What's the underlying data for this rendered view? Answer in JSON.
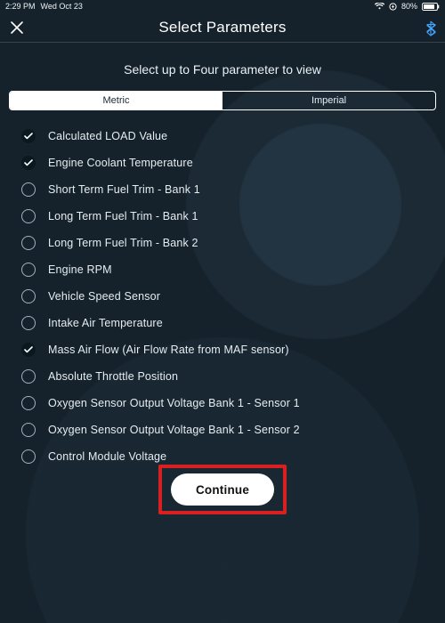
{
  "status": {
    "time": "2:29 PM",
    "date": "Wed Oct 23",
    "battery_pct": "80%"
  },
  "header": {
    "title": "Select Parameters"
  },
  "subtitle": "Select up to Four parameter to view",
  "units": {
    "metric_label": "Metric",
    "imperial_label": "Imperial",
    "active": "metric"
  },
  "parameters": [
    {
      "label": "Calculated LOAD Value",
      "checked": true
    },
    {
      "label": "Engine Coolant Temperature",
      "checked": true
    },
    {
      "label": "Short Term Fuel Trim - Bank 1",
      "checked": false
    },
    {
      "label": "Long Term Fuel Trim - Bank 1",
      "checked": false
    },
    {
      "label": "Long Term Fuel Trim - Bank 2",
      "checked": false
    },
    {
      "label": "Engine RPM",
      "checked": false
    },
    {
      "label": "Vehicle Speed Sensor",
      "checked": false
    },
    {
      "label": "Intake Air Temperature",
      "checked": false
    },
    {
      "label": "Mass Air Flow (Air Flow Rate from MAF sensor)",
      "checked": true
    },
    {
      "label": "Absolute Throttle Position",
      "checked": false
    },
    {
      "label": "Oxygen Sensor Output Voltage Bank 1 - Sensor 1",
      "checked": false
    },
    {
      "label": "Oxygen Sensor Output Voltage Bank 1 - Sensor 2",
      "checked": false
    },
    {
      "label": "Control Module Voltage",
      "checked": false
    }
  ],
  "cta": {
    "continue_label": "Continue"
  },
  "bg_gauge_pct": "27%"
}
